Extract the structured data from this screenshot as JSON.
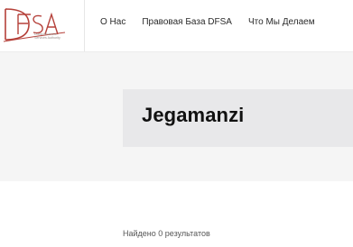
{
  "logo": {
    "wordmark": "DFSA",
    "tagline_lines": [
      "Dubai Financial",
      "Services Authority"
    ]
  },
  "nav": {
    "items": [
      {
        "label": "О Нас"
      },
      {
        "label": "Правовая База DFSA"
      },
      {
        "label": "Что Мы Делаем"
      }
    ]
  },
  "hero": {
    "title": "Jegamanzi"
  },
  "results": {
    "summary": "Найдено 0 результатов"
  },
  "colors": {
    "brand_red": "#b5413a",
    "hero_bg": "#f5f5f5",
    "title_box_bg": "#e8e8ea"
  }
}
